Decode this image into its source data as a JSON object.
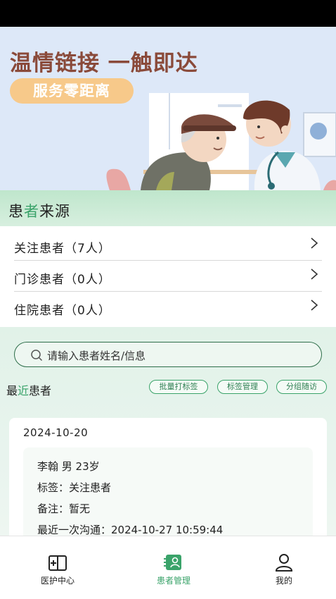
{
  "banner": {
    "title": "温情链接 一触即达",
    "subtitle": "服务零距离"
  },
  "patient_source": {
    "title_prefix": "患",
    "title_highlight": "者",
    "title_suffix": "来源",
    "items": [
      {
        "label": "关注患者（7人）"
      },
      {
        "label": "门诊患者（0人）"
      },
      {
        "label": "住院患者（0人）"
      }
    ]
  },
  "search": {
    "placeholder": "请输入患者姓名/信息"
  },
  "recent": {
    "title_prefix": "最",
    "title_highlight": "近",
    "title_suffix": "患者",
    "actions": [
      {
        "label": "批量打标签"
      },
      {
        "label": "标签管理"
      },
      {
        "label": "分组随访"
      }
    ]
  },
  "record": {
    "date": "2024-10-20",
    "name_line": "李翰  男 23岁",
    "tag_line": "标签：关注患者",
    "note_line": "备注：暂无",
    "last_contact_line": "最近一次沟通：2024-10-27 10:59:44"
  },
  "tabbar": {
    "items": [
      {
        "label": "医护中心",
        "icon": "medical-kit-icon"
      },
      {
        "label": "患者管理",
        "icon": "patient-card-icon"
      },
      {
        "label": "我的",
        "icon": "person-icon"
      }
    ]
  },
  "colors": {
    "accent": "#3aa36a",
    "banner_bg": "#dde8f8",
    "title_brown": "#8a4a3a",
    "pill": "#f7c98a"
  }
}
